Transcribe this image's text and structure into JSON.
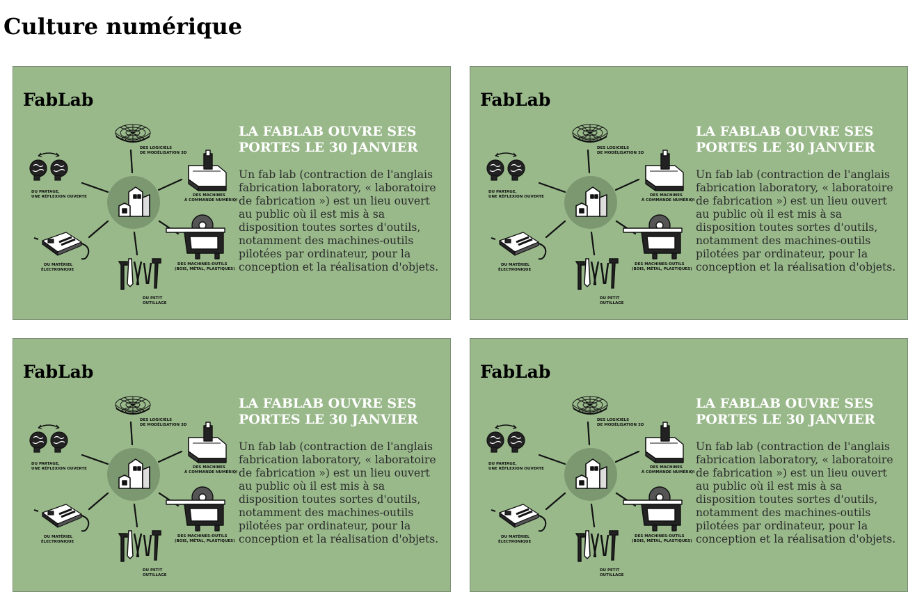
{
  "page": {
    "title": "Culture numérique"
  },
  "cards": [
    {
      "title": "FabLab",
      "headline": "LA FABLAB OUVRE SES PORTES LE 30 JANVIER",
      "body": "Un fab lab (contraction de l'anglais fabrication laboratory, « laboratoire de fabrication ») est un lieu ouvert au public où il est mis à sa disposition toutes sortes d'outils, notamment des machines-outils pilotées par ordinateur, pour la conception et la réalisation d'objets.",
      "illustration": {
        "labels": {
          "software": [
            "DES LOGICIELS",
            "DE MODÉLISATION 3D"
          ],
          "sharing": [
            "DU PARTAGE,",
            "UNE RÉFLEXION OUVERTE"
          ],
          "cnc": [
            "DES MACHINES",
            "À COMMANDE NUMÉRIQUE"
          ],
          "electronics": [
            "DU MATÉRIEL",
            "ÉLECTRONIQUE"
          ],
          "tools": [
            "DU PETIT",
            "OUTILLAGE"
          ],
          "machine_tools": [
            "DES MACHINES-OUTILS",
            "(BOIS, MÉTAL, PLASTIQUES)"
          ]
        }
      }
    },
    {
      "title": "FabLab",
      "headline": "LA FABLAB OUVRE SES PORTES LE 30 JANVIER",
      "body": "Un fab lab (contraction de l'anglais fabrication laboratory, « laboratoire de fabrication ») est un lieu ouvert au public où il est mis à sa disposition toutes sortes d'outils, notamment des machines-outils pilotées par ordinateur, pour la conception et la réalisation d'objets.",
      "illustration": {
        "labels": {
          "software": [
            "DES LOGICIELS",
            "DE MODÉLISATION 3D"
          ],
          "sharing": [
            "DU PARTAGE,",
            "UNE RÉFLEXION OUVERTE"
          ],
          "cnc": [
            "DES MACHINES",
            "À COMMANDE NUMÉRIQUE"
          ],
          "electronics": [
            "DU MATÉRIEL",
            "ÉLECTRONIQUE"
          ],
          "tools": [
            "DU PETIT",
            "OUTILLAGE"
          ],
          "machine_tools": [
            "DES MACHINES-OUTILS",
            "(BOIS, MÉTAL, PLASTIQUES)"
          ]
        }
      }
    },
    {
      "title": "FabLab",
      "headline": "LA FABLAB OUVRE SES PORTES LE 30 JANVIER",
      "body": "Un fab lab (contraction de l'anglais fabrication laboratory, « laboratoire de fabrication ») est un lieu ouvert au public où il est mis à sa disposition toutes sortes d'outils, notamment des machines-outils pilotées par ordinateur, pour la conception et la réalisation d'objets.",
      "illustration": {
        "labels": {
          "software": [
            "DES LOGICIELS",
            "DE MODÉLISATION 3D"
          ],
          "sharing": [
            "DU PARTAGE,",
            "UNE RÉFLEXION OUVERTE"
          ],
          "cnc": [
            "DES MACHINES",
            "À COMMANDE NUMÉRIQUE"
          ],
          "electronics": [
            "DU MATÉRIEL",
            "ÉLECTRONIQUE"
          ],
          "tools": [
            "DU PETIT",
            "OUTILLAGE"
          ],
          "machine_tools": [
            "DES MACHINES-OUTILS",
            "(BOIS, MÉTAL, PLASTIQUES)"
          ]
        }
      }
    },
    {
      "title": "FabLab",
      "headline": "LA FABLAB OUVRE SES PORTES LE 30 JANVIER",
      "body": "Un fab lab (contraction de l'anglais fabrication laboratory, « laboratoire de fabrication ») est un lieu ouvert au public où il est mis à sa disposition toutes sortes d'outils, notamment des machines-outils pilotées par ordinateur, pour la conception et la réalisation d'objets.",
      "illustration": {
        "labels": {
          "software": [
            "DES LOGICIELS",
            "DE MODÉLISATION 3D"
          ],
          "sharing": [
            "DU PARTAGE,",
            "UNE RÉFLEXION OUVERTE"
          ],
          "cnc": [
            "DES MACHINES",
            "À COMMANDE NUMÉRIQUE"
          ],
          "electronics": [
            "DU MATÉRIEL",
            "ÉLECTRONIQUE"
          ],
          "tools": [
            "DU PETIT",
            "OUTILLAGE"
          ],
          "machine_tools": [
            "DES MACHINES-OUTILS",
            "(BOIS, MÉTAL, PLASTIQUES)"
          ]
        }
      }
    }
  ],
  "colors": {
    "card_bg": "#99b98b",
    "headline": "#ffffff",
    "hub": "#7b9870"
  }
}
